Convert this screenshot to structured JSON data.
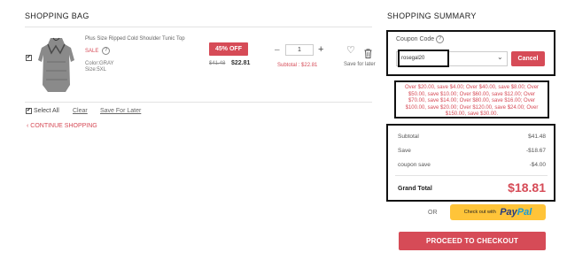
{
  "bag": {
    "title": "SHOPPING BAG",
    "item": {
      "checkbox": "✔",
      "name": "Plus Size Ripped Cold Shoulder Tunic Top",
      "sale_tag": "SALE",
      "help_glyph": "?",
      "color": "Color:GRAY",
      "size": "Size:5XL",
      "discount_badge": "45% OFF",
      "original_price": "$41.48",
      "current_price": "$22.81",
      "qty_minus": "–",
      "quantity": "1",
      "qty_plus": "+",
      "subtotal": "Subtotal : $22.81",
      "wishlist_glyph": "♡",
      "save_for_later": "Save for later"
    },
    "footer": {
      "select_all_check": "✔",
      "select_all": "Select All",
      "clear": "Clear",
      "save_for_later": "Save For Later",
      "continue_shopping": "‹  CONTINUE SHOPPING"
    }
  },
  "summary": {
    "title": "SHOPPING SUMMARY",
    "coupon_label": "Coupon Code",
    "coupon_help": "?",
    "coupon_value": "rosegal20",
    "select_chevron": "⌄",
    "cancel_label": "Cancel",
    "promo_text": "Over $20.00, save $4.00; Over $40.00, save $8.00; Over $50.00, save $10.00; Over $60.00, save $12.00; Over $70.00, save $14.00; Over $80.00, save $16.00; Over $100.00, save $20.00; Over $120.00, save $24.00; Over $150.00, save $30.00.",
    "rows": {
      "subtotal_label": "Subtotal",
      "subtotal_value": "$41.48",
      "save_label": "Save",
      "save_value": "-$18.67",
      "coupon_save_label": "coupon save",
      "coupon_save_value": "-$4.00"
    },
    "grand_total_label": "Grand Total",
    "grand_total_value": "$18.81",
    "or_label": "OR",
    "paypal_prefix": "Check out with",
    "paypal_brand_a": "Pay",
    "paypal_brand_b": "Pal",
    "checkout_label": "PROCEED TO CHECKOUT"
  },
  "colors": {
    "accent": "#d64b57",
    "paypal_yellow": "#ffc439"
  }
}
